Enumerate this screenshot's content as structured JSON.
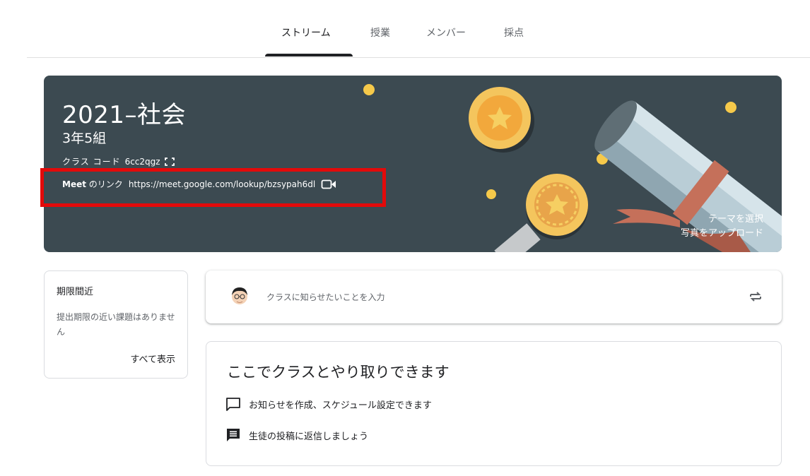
{
  "tabs": [
    {
      "label": "ストリーム",
      "active": true
    },
    {
      "label": "授業",
      "active": false
    },
    {
      "label": "メンバー",
      "active": false
    },
    {
      "label": "採点",
      "active": false
    }
  ],
  "banner": {
    "title": "2021–社会",
    "section": "3年5組",
    "class_code_label": "クラス コード",
    "class_code": "6cc2qgz",
    "meet_label": "Meet",
    "meet_label_suffix": "のリンク",
    "meet_url": "https://meet.google.com/lookup/bzsypah6dl",
    "select_theme": "テーマを選択",
    "upload_photo": "写真をアップロード",
    "background_color": "#3c4a51"
  },
  "upcoming": {
    "heading": "期限間近",
    "body": "提出期限の近い課題はありません",
    "view_all": "すべて表示"
  },
  "announce": {
    "placeholder": "クラスに知らせたいことを入力"
  },
  "info": {
    "title": "ここでクラスとやり取りできます",
    "items": [
      {
        "icon": "comment-icon",
        "text": "お知らせを作成、スケジュール設定できます"
      },
      {
        "icon": "message-icon",
        "text": "生徒の投稿に返信しましょう"
      }
    ]
  },
  "highlight_color": "#e30a0a"
}
